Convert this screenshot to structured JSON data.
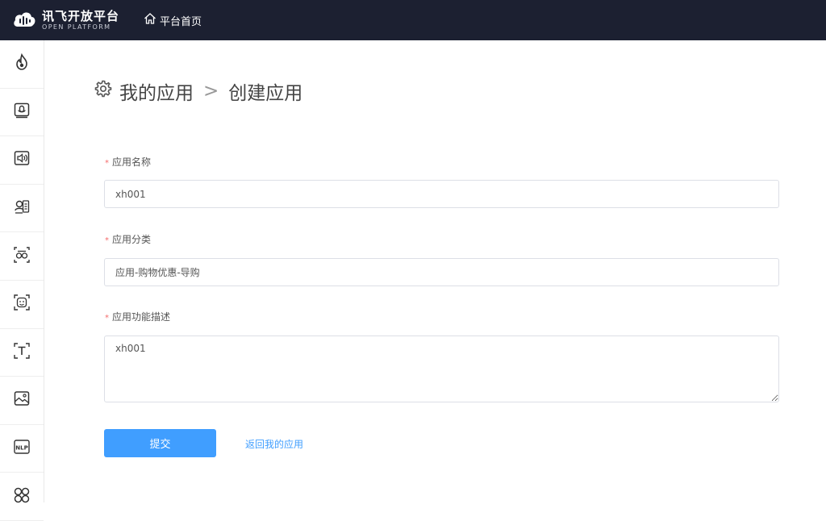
{
  "header": {
    "logo_cn": "讯飞开放平台",
    "logo_en": "OPEN PLATFORM",
    "home_label": "平台首页"
  },
  "sidebar": {
    "icons": [
      "flame-icon",
      "microphone-icon",
      "speaker-icon",
      "face-document-icon",
      "voiceprint-icon",
      "face-scan-icon",
      "text-recognition-icon",
      "image-icon",
      "nlp-icon",
      "apps-grid-icon"
    ],
    "nlp_text": "NLP"
  },
  "breadcrumb": {
    "root": "我的应用",
    "separator": ">",
    "current": "创建应用"
  },
  "form": {
    "required_mark": "*",
    "name_label": "应用名称",
    "name_value": "xh001",
    "category_label": "应用分类",
    "category_value": "应用-购物优惠-导购",
    "desc_label": "应用功能描述",
    "desc_value": "xh001",
    "submit_label": "提交",
    "back_label": "返回我的应用"
  },
  "colors": {
    "topbar": "#1c2031",
    "primary": "#409eff",
    "required": "#f56c6c"
  }
}
